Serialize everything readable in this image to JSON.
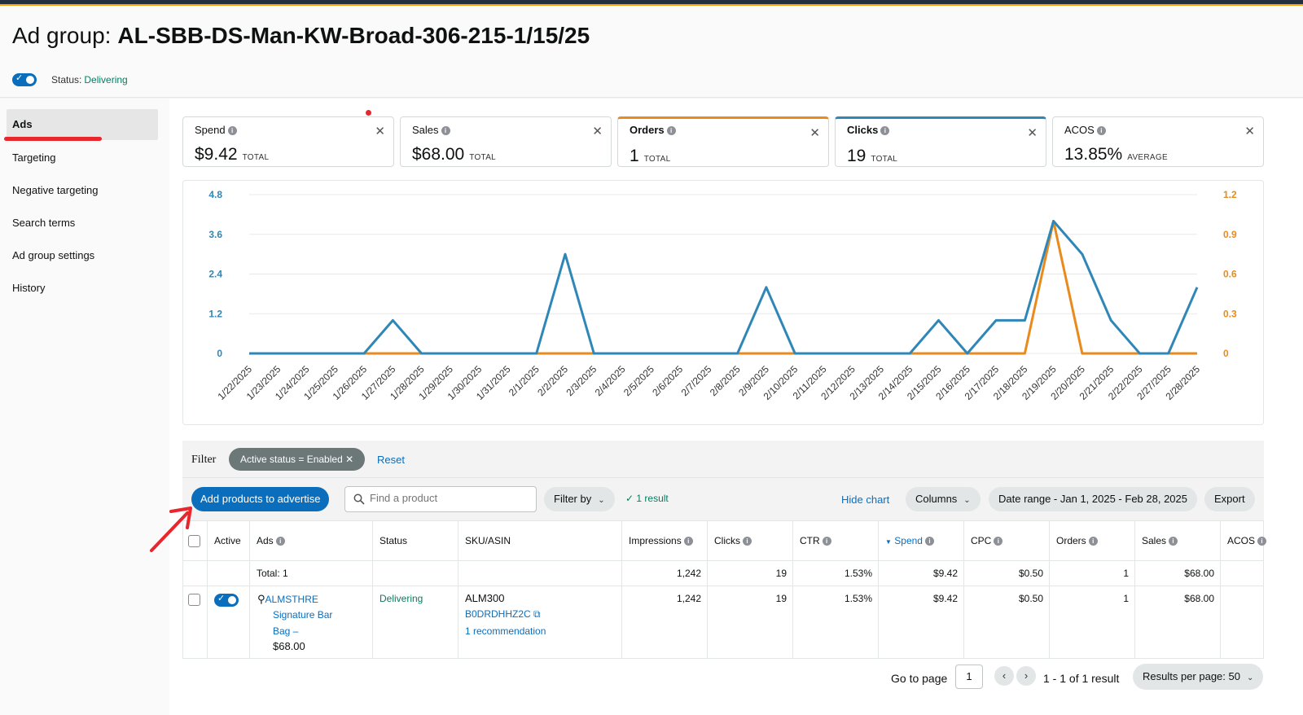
{
  "header": {
    "title_prefix": "Ad group:",
    "title_name": "AL-SBB-DS-Man-KW-Broad-306-215-1/15/25",
    "status_label": "Status:",
    "status_value": "Delivering"
  },
  "sidebar": {
    "items": [
      {
        "label": "Ads"
      },
      {
        "label": "Targeting"
      },
      {
        "label": "Negative targeting"
      },
      {
        "label": "Search terms"
      },
      {
        "label": "Ad group settings"
      },
      {
        "label": "History"
      }
    ]
  },
  "metrics": [
    {
      "name": "Spend",
      "value": "$9.42",
      "type": "TOTAL"
    },
    {
      "name": "Sales",
      "value": "$68.00",
      "type": "TOTAL"
    },
    {
      "name": "Orders",
      "value": "1",
      "type": "TOTAL"
    },
    {
      "name": "Clicks",
      "value": "19",
      "type": "TOTAL"
    },
    {
      "name": "ACOS",
      "value": "13.85%",
      "type": "AVERAGE"
    }
  ],
  "colors": {
    "clicks": "#2f87b8",
    "orders": "#e98b1c",
    "primary": "#0a6ebd"
  },
  "chart_data": {
    "type": "line",
    "x": [
      "1/22/2025",
      "1/23/2025",
      "1/24/2025",
      "1/25/2025",
      "1/26/2025",
      "1/27/2025",
      "1/28/2025",
      "1/29/2025",
      "1/30/2025",
      "1/31/2025",
      "2/1/2025",
      "2/2/2025",
      "2/3/2025",
      "2/4/2025",
      "2/5/2025",
      "2/6/2025",
      "2/7/2025",
      "2/8/2025",
      "2/9/2025",
      "2/10/2025",
      "2/11/2025",
      "2/12/2025",
      "2/13/2025",
      "2/14/2025",
      "2/15/2025",
      "2/16/2025",
      "2/17/2025",
      "2/18/2025",
      "2/19/2025",
      "2/20/2025",
      "2/21/2025",
      "2/22/2025",
      "2/27/2025",
      "2/28/2025"
    ],
    "series": [
      {
        "name": "Clicks",
        "axis": "left",
        "values": [
          0,
          0,
          0,
          0,
          0,
          1,
          0,
          0,
          0,
          0,
          0,
          3,
          0,
          0,
          0,
          0,
          0,
          0,
          2,
          0,
          0,
          0,
          0,
          0,
          1,
          0,
          1,
          1,
          4,
          3,
          1,
          0,
          0,
          2
        ]
      },
      {
        "name": "Orders",
        "axis": "right",
        "values": [
          0,
          0,
          0,
          0,
          0,
          0,
          0,
          0,
          0,
          0,
          0,
          0,
          0,
          0,
          0,
          0,
          0,
          0,
          0,
          0,
          0,
          0,
          0,
          0,
          0,
          0,
          0,
          0,
          1,
          0,
          0,
          0,
          0,
          0
        ]
      }
    ],
    "left_ticks": [
      "0",
      "1.2",
      "2.4",
      "3.6",
      "4.8"
    ],
    "right_ticks": [
      "0",
      "0.3",
      "0.6",
      "0.9",
      "1.2"
    ],
    "ylim_left": [
      0,
      4.8
    ],
    "ylim_right": [
      0,
      1.2
    ],
    "grid": true
  },
  "filter": {
    "label": "Filter",
    "chip": "Active status = Enabled",
    "reset": "Reset"
  },
  "toolbar": {
    "add_button": "Add products to advertise",
    "search_placeholder": "Find a product",
    "filter_by": "Filter by",
    "result": "1 result",
    "hide_chart": "Hide chart",
    "columns": "Columns",
    "date_range": "Date range - Jan 1, 2025 - Feb 28, 2025",
    "export": "Export"
  },
  "table": {
    "headers": [
      "Active",
      "Ads",
      "Status",
      "SKU/ASIN",
      "Impressions",
      "Clicks",
      "CTR",
      "Spend",
      "CPC",
      "Orders",
      "Sales",
      "ACOS"
    ],
    "total": {
      "label": "Total: 1",
      "impressions": "1,242",
      "clicks": "19",
      "ctr": "1.53%",
      "spend": "$9.42",
      "cpc": "$0.50",
      "orders": "1",
      "sales": "$68.00"
    },
    "rows": [
      {
        "ad_brand": "ALMSTHRE",
        "ad_line2": "Signature Bar",
        "ad_line3": "Bag –",
        "price": "$68.00",
        "status": "Delivering",
        "sku": "ALM300",
        "asin": "B0DRDHHZ2C",
        "recommendation": "1 recommendation",
        "impressions": "1,242",
        "clicks": "19",
        "ctr": "1.53%",
        "spend": "$9.42",
        "cpc": "$0.50",
        "orders": "1",
        "sales": "$68.00"
      }
    ]
  },
  "pagination": {
    "go_to_page": "Go to page",
    "page": "1",
    "summary": "1 - 1 of 1 result",
    "results_per_page": "Results per page: 50"
  }
}
